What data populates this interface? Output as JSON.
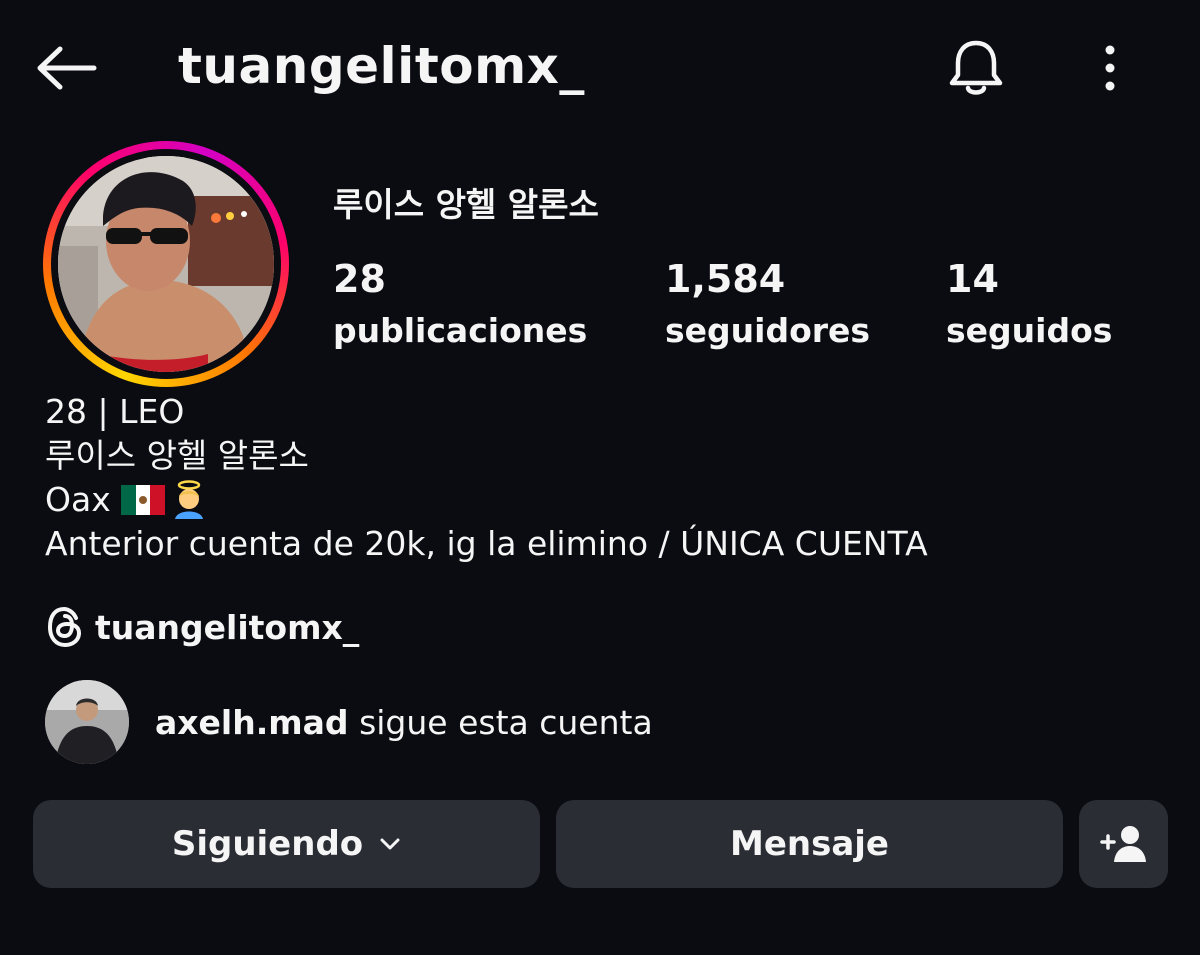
{
  "header": {
    "username": "tuangelitomx_",
    "back_icon": "arrow-left-icon",
    "notification_icon": "bell-icon",
    "more_icon": "more-vertical-icon"
  },
  "profile": {
    "display_name": "루이스 앙헬 알론소",
    "stats": [
      {
        "value": "28",
        "label": "publicaciones"
      },
      {
        "value": "1,584",
        "label": "seguidores"
      },
      {
        "value": "14",
        "label": "seguidos"
      }
    ],
    "bio": {
      "line1": "28 | LEO",
      "line2": "루이스 앙헬 알론소",
      "line3": "Oax",
      "line3_emojis": [
        "mexico-flag",
        "angel"
      ],
      "line4": "Anterior cuenta de 20k, ig la elimino / ÚNICA CUENTA"
    },
    "threads": {
      "icon": "threads-icon",
      "handle": "tuangelitomx_"
    },
    "followed_by": {
      "user": "axelh.mad",
      "text": "sigue esta cuenta"
    }
  },
  "actions": {
    "following_label": "Siguiendo",
    "message_label": "Mensaje",
    "add_icon": "add-person-icon"
  },
  "colors": {
    "background": "#0b0b12",
    "button_bg": "#2a2d34",
    "text": "#f5f5f5",
    "ring_colors": [
      "#ffd600",
      "#ff7a00",
      "#ff0169",
      "#d300c5"
    ]
  }
}
